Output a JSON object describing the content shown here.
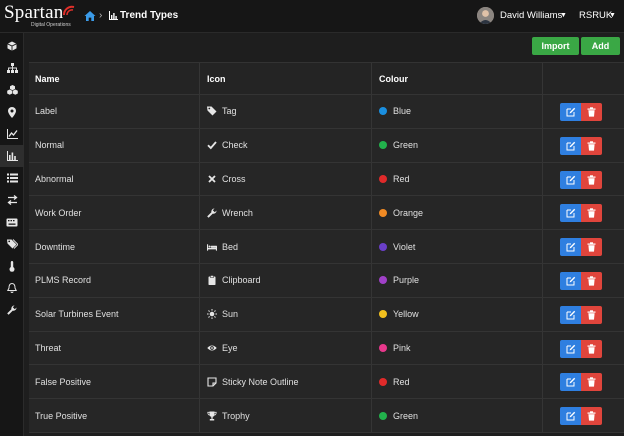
{
  "header": {
    "logo_text": "Spartan",
    "logo_subtitle": "Digital Operations",
    "breadcrumb_title": "Trend Types",
    "user_name": "David Williams",
    "org_name": "RSRUK"
  },
  "sidebar": {
    "items": [
      {
        "icon": "cube-icon"
      },
      {
        "icon": "sitemap-icon"
      },
      {
        "icon": "cubes-icon"
      },
      {
        "icon": "map-marker-icon"
      },
      {
        "icon": "line-chart-icon"
      },
      {
        "icon": "bar-chart-icon",
        "active": true
      },
      {
        "icon": "list-icon"
      },
      {
        "icon": "exchange-icon"
      },
      {
        "icon": "keyboard-icon"
      },
      {
        "icon": "tags-icon"
      },
      {
        "icon": "thermometer-icon"
      },
      {
        "icon": "bell-icon"
      },
      {
        "icon": "wrench-icon"
      }
    ]
  },
  "toolbar": {
    "import_label": "Import",
    "add_label": "Add"
  },
  "table": {
    "headers": {
      "name": "Name",
      "icon": "Icon",
      "colour": "Colour"
    },
    "rows": [
      {
        "name": "Label",
        "icon": "Tag",
        "colour": "Blue",
        "colour_hex": "#1a8fe0"
      },
      {
        "name": "Normal",
        "icon": "Check",
        "colour": "Green",
        "colour_hex": "#22b24c"
      },
      {
        "name": "Abnormal",
        "icon": "Cross",
        "colour": "Red",
        "colour_hex": "#e02a2a"
      },
      {
        "name": "Work Order",
        "icon": "Wrench",
        "colour": "Orange",
        "colour_hex": "#f08a24"
      },
      {
        "name": "Downtime",
        "icon": "Bed",
        "colour": "Violet",
        "colour_hex": "#6a3fc8"
      },
      {
        "name": "PLMS Record",
        "icon": "Clipboard",
        "colour": "Purple",
        "colour_hex": "#a040c8"
      },
      {
        "name": "Solar Turbines Event",
        "icon": "Sun",
        "colour": "Yellow",
        "colour_hex": "#f2c01e"
      },
      {
        "name": "Threat",
        "icon": "Eye",
        "colour": "Pink",
        "colour_hex": "#e8388c"
      },
      {
        "name": "False Positive",
        "icon": "Sticky Note Outline",
        "colour": "Red",
        "colour_hex": "#e02a2a"
      },
      {
        "name": "True Positive",
        "icon": "Trophy",
        "colour": "Green",
        "colour_hex": "#22b24c"
      }
    ]
  },
  "colors": {
    "import_button": "#3aa845",
    "add_button": "#3aa845",
    "edit_button": "#2f7fe0",
    "delete_button": "#e0453c",
    "breadcrumb_home": "#3b9be8"
  }
}
